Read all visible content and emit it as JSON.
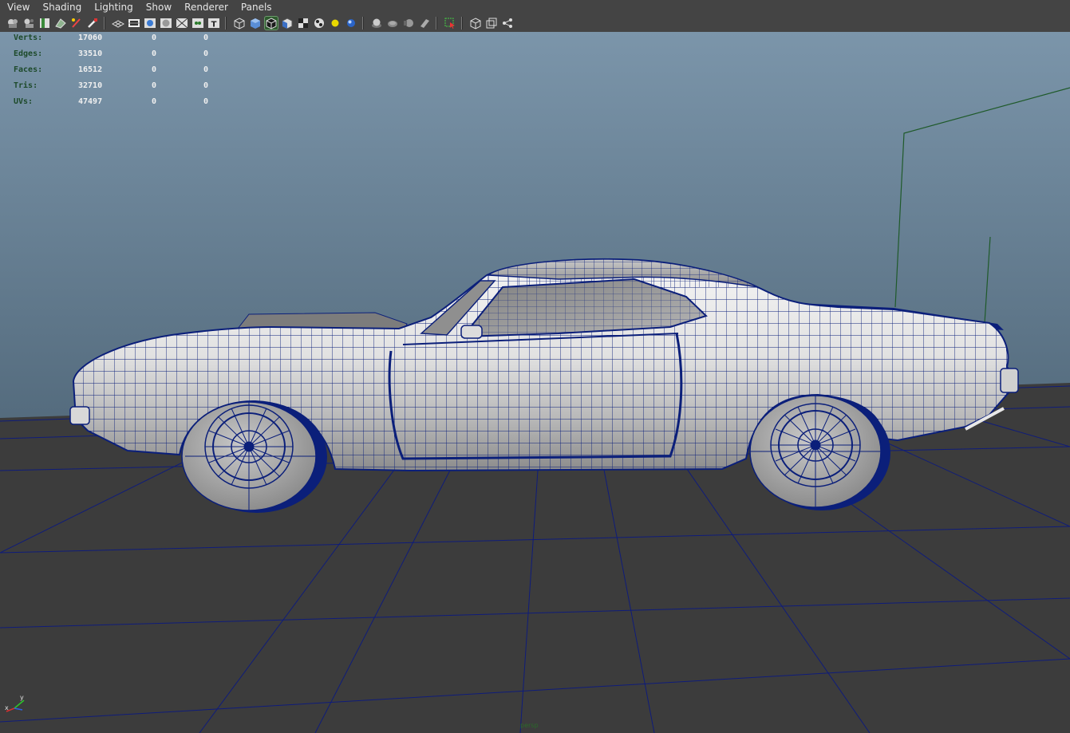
{
  "menubar": {
    "items": [
      {
        "label": "View"
      },
      {
        "label": "Shading"
      },
      {
        "label": "Lighting"
      },
      {
        "label": "Show"
      },
      {
        "label": "Renderer"
      },
      {
        "label": "Panels"
      }
    ]
  },
  "toolbar": {
    "icons": [
      "camera-select-icon",
      "camera-attributes-icon",
      "bookmark-icon",
      "image-plane-icon",
      "grease-pencil-icon",
      "2d-pan-zoom-icon",
      "grid-toggle-icon",
      "film-gate-icon",
      "resolution-gate-icon",
      "gate-mask-icon",
      "field-chart-icon",
      "safe-action-icon",
      "safe-title-icon",
      "wireframe-icon",
      "smooth-shade-icon",
      "wireframe-on-shaded-icon",
      "flat-shade-icon",
      "bounding-box-icon",
      "use-default-material-icon",
      "textured-icon",
      "use-all-lights-icon",
      "shadows-icon",
      "screen-space-ao-icon",
      "motion-blur-icon",
      "anti-aliasing-icon",
      "depth-of-field-icon",
      "select-camera-icon",
      "isolate-select-icon",
      "xray-icon",
      "xray-joints-icon"
    ]
  },
  "hud": {
    "rows": [
      {
        "label": "Verts:",
        "v1": "17060",
        "v2": "0",
        "v3": "0"
      },
      {
        "label": "Edges:",
        "v1": "33510",
        "v2": "0",
        "v3": "0"
      },
      {
        "label": "Faces:",
        "v1": "16512",
        "v2": "0",
        "v3": "0"
      },
      {
        "label": "Tris:",
        "v1": "32710",
        "v2": "0",
        "v3": "0"
      },
      {
        "label": "UVs:",
        "v1": "47497",
        "v2": "0",
        "v3": "0"
      }
    ]
  },
  "axis": {
    "x": "x",
    "y": "y"
  },
  "status": {
    "camera": "persp"
  },
  "colors": {
    "wire": "#0b1f7a",
    "grid": "#0f1c7a",
    "floor": "#3f3f3f",
    "sky_top": "#7a94a8",
    "sky_bottom": "#2f3f4b"
  }
}
